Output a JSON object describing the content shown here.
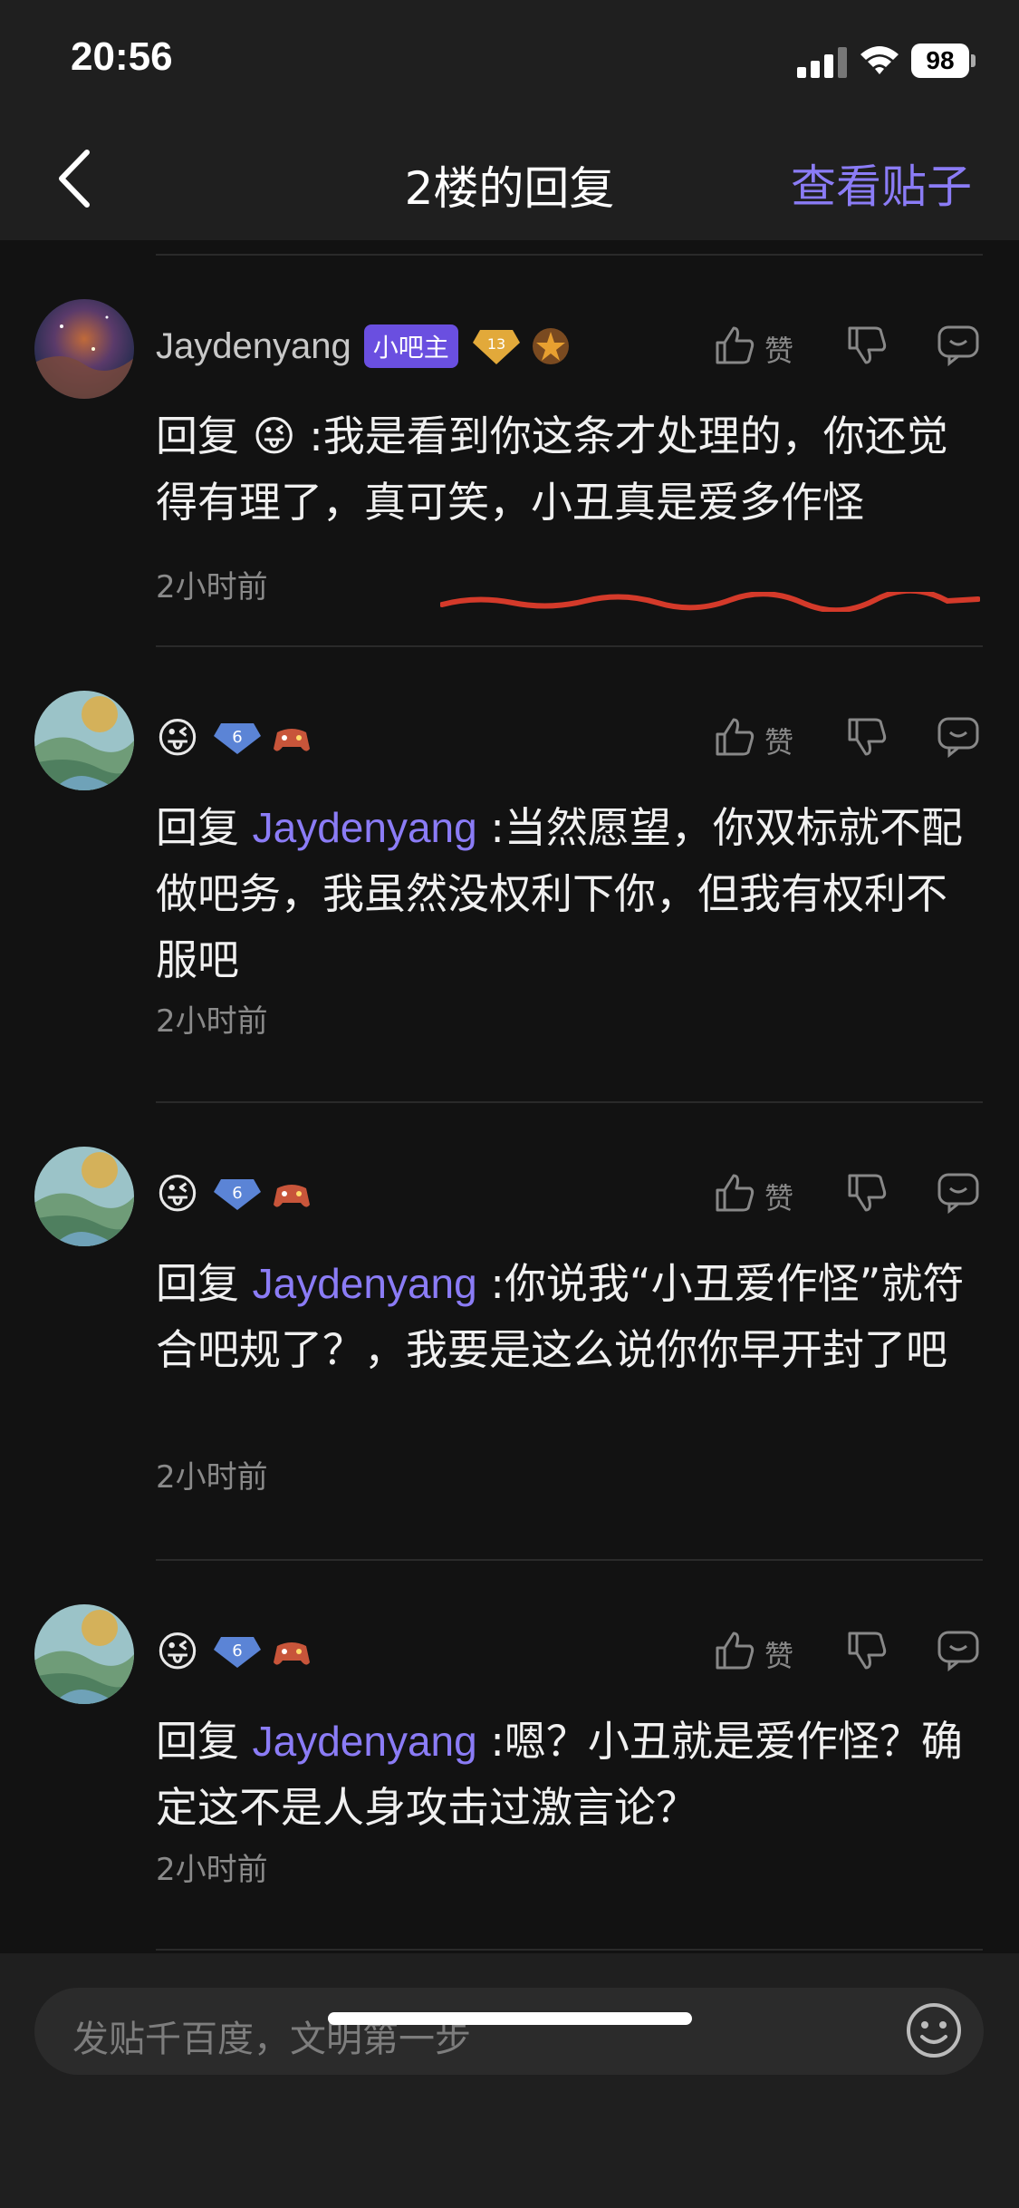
{
  "status_bar": {
    "time": "20:56",
    "battery": "98"
  },
  "nav": {
    "title": "2楼的回复",
    "view_post_label": "查看贴子"
  },
  "comments": [
    {
      "username": "Jaydenyang",
      "mod_badge": "小吧主",
      "level": "13",
      "like_label": "赞",
      "body": "回复 😜 :我是看到你这条才处理的，你还觉得有理了，真可笑，小丑真是爱多作怪",
      "time": "2小时前"
    },
    {
      "name_emoji": "😜",
      "level": "6",
      "like_label": "赞",
      "reply_prefix": "回复 ",
      "mention": "Jaydenyang",
      "body": " :当然愿望，你双标就不配做吧务，我虽然没权利下你，但我有权利不服吧",
      "time": "2小时前"
    },
    {
      "name_emoji": "😜",
      "level": "6",
      "like_label": "赞",
      "reply_prefix": "回复 ",
      "mention": "Jaydenyang",
      "body": " :你说我“小丑爱作怪”就符合吧规了？，我要是这么说你你早开封了吧",
      "time": "2小时前"
    },
    {
      "name_emoji": "😜",
      "level": "6",
      "like_label": "赞",
      "reply_prefix": "回复 ",
      "mention": "Jaydenyang",
      "body": " :嗯？小丑就是爱作怪？确定这不是人身攻击过激言论？",
      "time": "2小时前"
    }
  ],
  "input": {
    "placeholder": "发贴千百度，文明第一步"
  },
  "colors": {
    "accent": "#8b7cf6",
    "background": "#121212",
    "bar": "#1f1f1f",
    "mod_badge": "#6a4fe0",
    "annotation": "#d43a2a"
  },
  "icons": [
    "signal-icon",
    "wifi-icon",
    "battery-icon",
    "back-icon",
    "like-icon",
    "dislike-icon",
    "reply-icon",
    "emoji-icon"
  ]
}
